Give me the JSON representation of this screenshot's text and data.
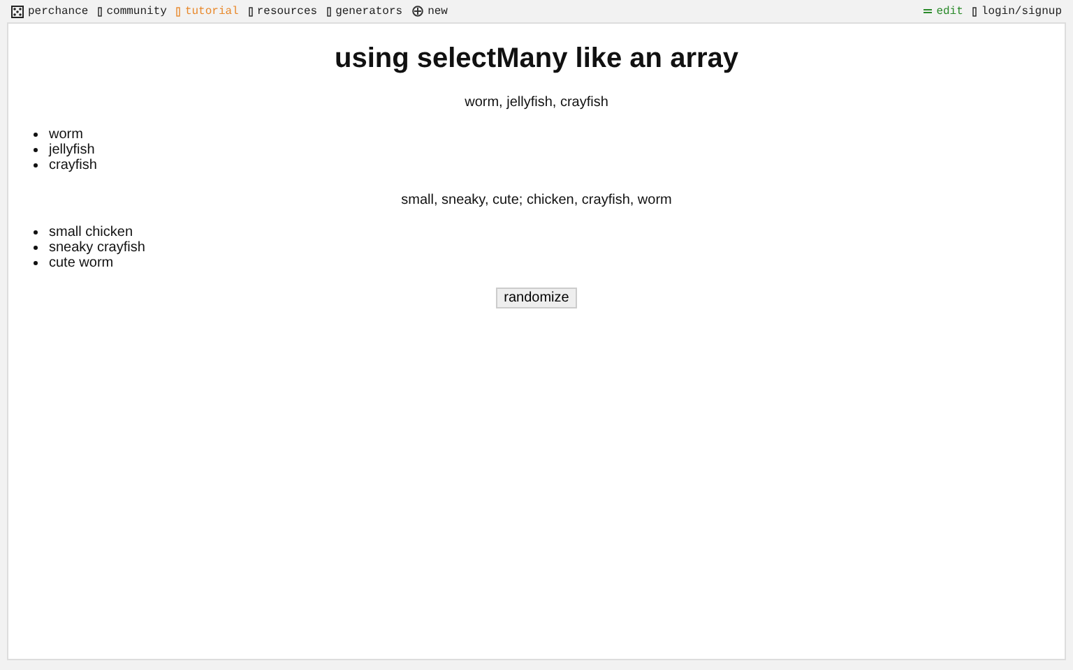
{
  "nav": [
    {
      "label": "perchance",
      "kind": "logo",
      "selected": false
    },
    {
      "label": "community",
      "kind": "link",
      "selected": false
    },
    {
      "label": "tutorial",
      "kind": "link",
      "selected": true
    },
    {
      "label": "resources",
      "kind": "link",
      "selected": false
    },
    {
      "label": "generators",
      "kind": "link",
      "selected": false
    },
    {
      "label": "new",
      "kind": "new",
      "selected": false
    }
  ],
  "nav_right": [
    {
      "label": "edit",
      "kind": "edit"
    },
    {
      "label": "login/signup",
      "kind": "link"
    }
  ],
  "title": "using selectMany like an array",
  "sections": [
    {
      "summary": "worm, jellyfish, crayfish",
      "items": [
        "worm",
        "jellyfish",
        "crayfish"
      ]
    },
    {
      "summary": "small, sneaky, cute; chicken, crayfish, worm",
      "items": [
        "small chicken",
        "sneaky crayfish",
        "cute worm"
      ]
    }
  ],
  "button": "randomize"
}
